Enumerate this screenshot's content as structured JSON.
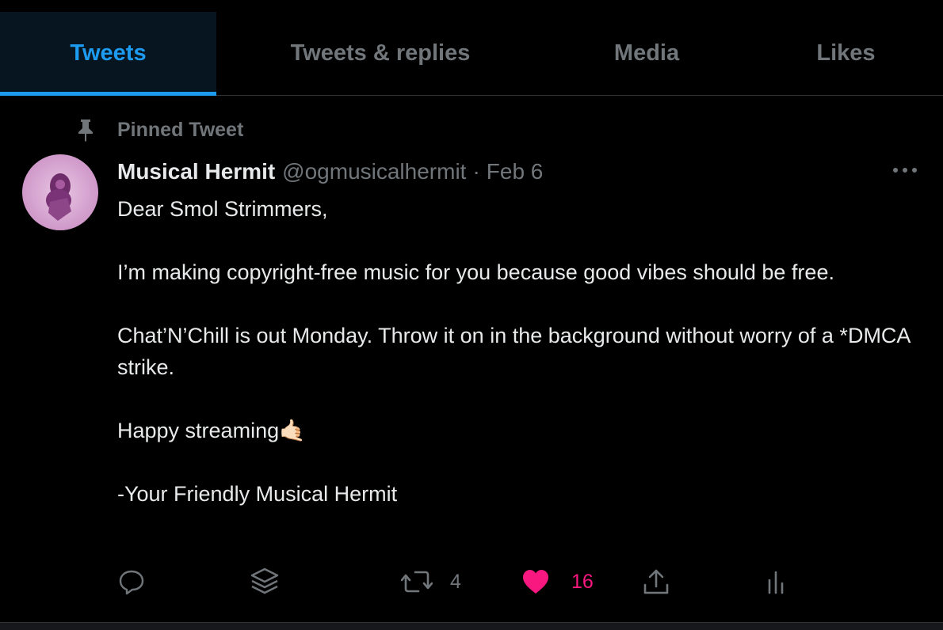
{
  "tabs": [
    {
      "label": "Tweets",
      "active": true
    },
    {
      "label": "Tweets & replies",
      "active": false
    },
    {
      "label": "Media",
      "active": false
    },
    {
      "label": "Likes",
      "active": false
    }
  ],
  "pinned": {
    "label": "Pinned Tweet",
    "icon": "pin-icon"
  },
  "tweet": {
    "name": "Musical Hermit",
    "handle": "@ogmusicalhermit",
    "separator": "·",
    "date": "Feb 6",
    "lines": [
      "Dear Smol Strimmers,",
      "I’m making copyright-free music for you because good vibes should be free.",
      "Chat’N’Chill is out Monday. Throw it on in the background without worry of a *DMCA strike.",
      "Happy streaming",
      "-Your Friendly Musical Hermit"
    ],
    "emoji": "🤙🏻"
  },
  "actions": {
    "reply": {
      "icon": "reply-icon"
    },
    "stack": {
      "icon": "stack-icon"
    },
    "retweet": {
      "icon": "retweet-icon",
      "count": "4"
    },
    "like": {
      "icon": "heart-icon",
      "count": "16",
      "liked": true
    },
    "share": {
      "icon": "share-icon"
    },
    "analytics": {
      "icon": "analytics-icon"
    }
  },
  "colors": {
    "accent": "#1d9bf0",
    "like": "#f91880",
    "muted": "#71767b",
    "text": "#e7e9ea",
    "background": "#000000"
  }
}
